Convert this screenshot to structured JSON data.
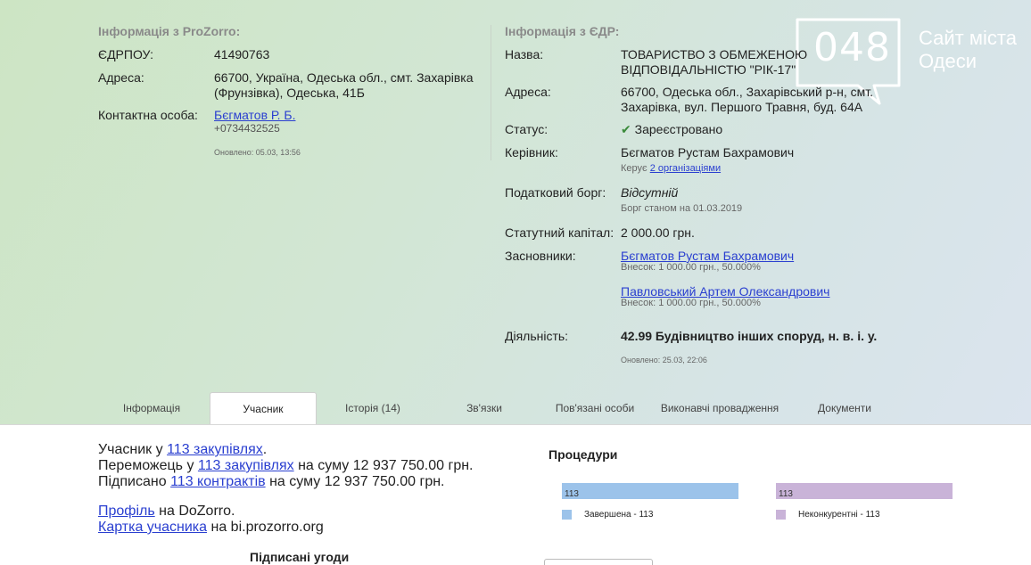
{
  "prozorro": {
    "title": "Інформація з ProZorro:",
    "edrpou_label": "ЄДРПОУ:",
    "edrpou_value": "41490763",
    "address_label": "Адреса:",
    "address_line1": "66700, Україна, Одеська обл., смт. Захарівка",
    "address_line2": "(Фрунзівка), Одеська, 41Б",
    "contact_label": "Контактна особа:",
    "contact_name": "Бєгматов Р. Б.",
    "contact_phone": "+0734432525",
    "updated": "Оновлено: 05.03, 13:56"
  },
  "edr": {
    "title": "Інформація з ЄДР:",
    "name_label": "Назва:",
    "name_line1": "ТОВАРИСТВО З ОБМЕЖЕНОЮ",
    "name_line2": "ВІДПОВІДАЛЬНІСТЮ \"РІК-17\"",
    "address_label": "Адреса:",
    "address_line1": "66700, Одеська обл., Захарівський р-н, смт.",
    "address_line2": "Захарівка, вул. Першого Травня, буд. 64А",
    "status_label": "Статус:",
    "status_value": "Зареєстровано",
    "head_label": "Керівник:",
    "head_name": "Бєгматов Рустам Бахрамович",
    "head_manages_prefix": "Керує",
    "head_manages_link": "2 організаціями",
    "tax_label": "Податковий борг:",
    "tax_value": "Відсутній",
    "tax_note": "Борг станом на 01.03.2019",
    "capital_label": "Статутний капітал:",
    "capital_value": "2 000.00 грн.",
    "founders_label": "Засновники:",
    "founders": [
      {
        "name": "Бєгматов Рустам Бахрамович",
        "share": "Внесок: 1 000.00 грн., 50.000%"
      },
      {
        "name": "Павловський Артем Олександрович",
        "share": "Внесок: 1 000.00 грн., 50.000%"
      }
    ],
    "activity_label": "Діяльність:",
    "activity_value": "42.99 Будівництво інших споруд, н. в. і. у.",
    "updated": "Оновлено: 25.03, 22:06"
  },
  "watermark": {
    "number": "048",
    "line1": "Сайт міста",
    "line2": "Одеси"
  },
  "tabs": [
    {
      "label": "Інформація",
      "active": false
    },
    {
      "label": "Учасник",
      "active": true
    },
    {
      "label": "Історія (14)",
      "active": false
    },
    {
      "label": "Зв'язки",
      "active": false
    },
    {
      "label": "Пов'язані особи",
      "active": false
    },
    {
      "label": "Виконавчі провадження",
      "active": false
    },
    {
      "label": "Документи",
      "active": false
    }
  ],
  "participant": {
    "l1_pre": "Учасник у",
    "l1_link": "113 закупівлях",
    "l1_post": ".",
    "l2_pre": "Переможець у",
    "l2_link": "113 закупівлях",
    "l2_post": "на суму 12 937 750.00 грн.",
    "l3_pre": "Підписано",
    "l3_link": "113 контрактів",
    "l3_post": "на суму 12 937 750.00 грн.",
    "l4_link": "Профіль",
    "l4_post": "на DoZorro.",
    "l5_link": "Картка учасника",
    "l5_post": "на bi.prozorro.org",
    "signed_title": "Підписані угоди"
  },
  "colors": {
    "bar_completed": "#9cc3ea",
    "bar_noncompetitive": "#c9b3d8"
  },
  "chart_data": {
    "type": "bar",
    "title": "Процедури",
    "series": [
      {
        "name": "Завершена - 113",
        "values": [
          113
        ]
      },
      {
        "name": "Неконкурентні - 113",
        "values": [
          113
        ]
      }
    ],
    "bar_labels": [
      "113",
      "113"
    ]
  }
}
